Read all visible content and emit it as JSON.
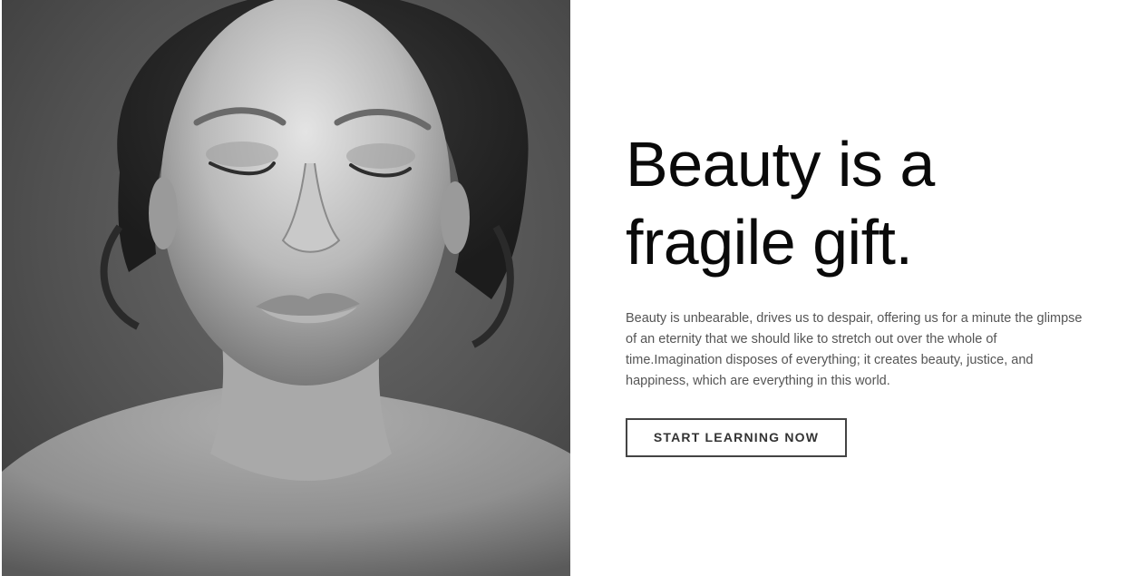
{
  "hero": {
    "headline_line1": "Beauty is a",
    "headline_line2": "fragile gift.",
    "body": "Beauty is unbearable, drives us to despair, offering us for a minute the glimpse of an eternity that we should like to stretch out over the whole of time.Imagination disposes of everything; it creates beauty, justice, and happiness, which are everything in this world.",
    "cta_label": "START LEARNING NOW"
  },
  "colors": {
    "background": "#ffffff",
    "headline": "#0a0a0a",
    "body_text": "#555555",
    "button_border": "#444444"
  }
}
